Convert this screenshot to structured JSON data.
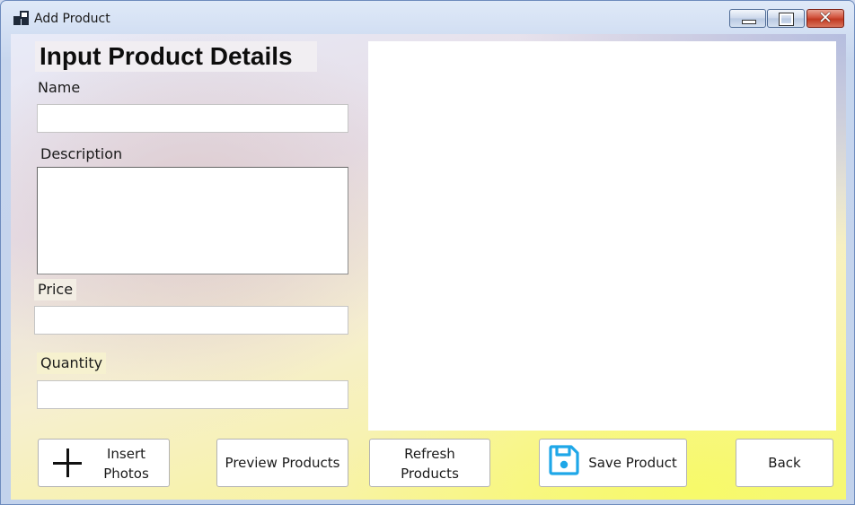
{
  "window": {
    "title": "Add Product",
    "controls": [
      "minimize",
      "maximize",
      "close"
    ]
  },
  "form": {
    "heading": "Input Product Details",
    "fields": {
      "name_label": "Name",
      "name_value": "",
      "description_label": "Description",
      "description_value": "",
      "price_label": "Price",
      "price_value": "",
      "quantity_label": "Quantity",
      "quantity_value": ""
    }
  },
  "buttons": {
    "insert_line1": "Insert",
    "insert_line2": "Photos",
    "preview": "Preview Products",
    "refresh_line1": "Refresh",
    "refresh_line2": "Products",
    "save": "Save Product",
    "back": "Back"
  },
  "icons": {
    "app": "app-window-icon",
    "insert": "plus-icon",
    "save": "floppy-disk-icon"
  },
  "colors": {
    "save_icon": "#1ea7e8",
    "close_button": "#c13a22"
  }
}
